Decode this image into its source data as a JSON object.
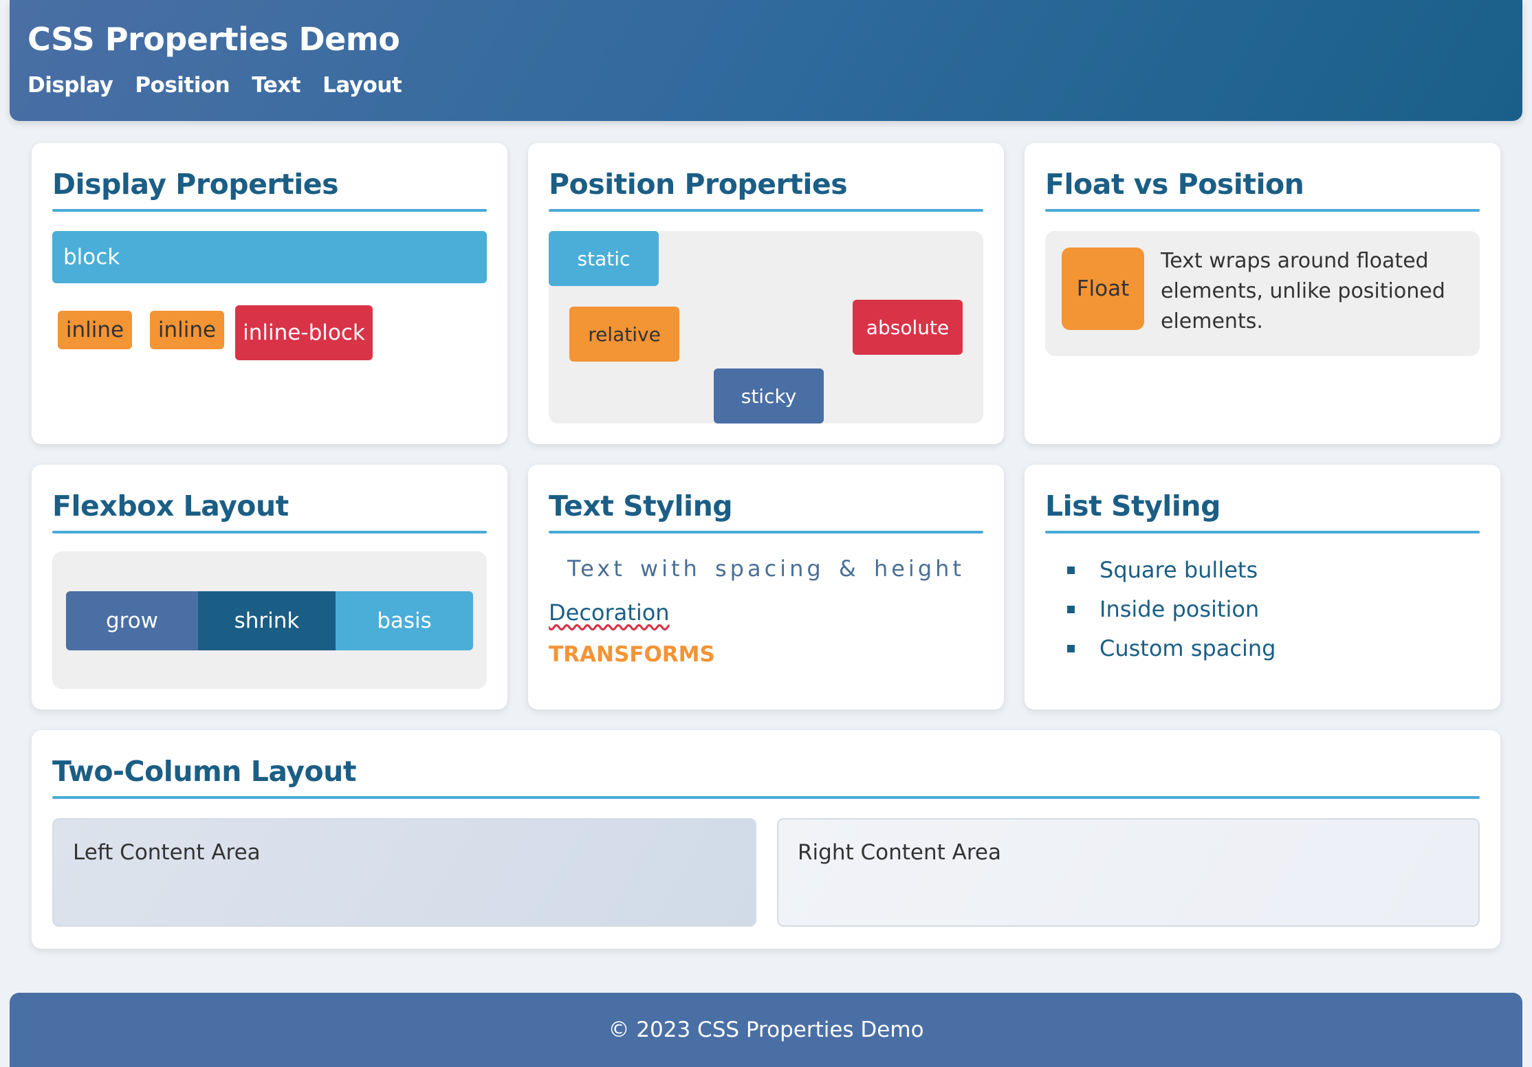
{
  "header": {
    "title": "CSS Properties Demo",
    "nav": [
      "Display",
      "Position",
      "Text",
      "Layout"
    ]
  },
  "display_card": {
    "title": "Display Properties",
    "block_label": "block",
    "inline_1": "inline",
    "inline_2": "inline",
    "inline_block": "inline-block"
  },
  "position_card": {
    "title": "Position Properties",
    "static": "static",
    "relative": "relative",
    "absolute": "absolute",
    "sticky": "sticky"
  },
  "float_card": {
    "title": "Float vs Position",
    "float_label": "Float",
    "wrap_text": "Text wraps around floated elements, unlike positioned elements."
  },
  "flex_card": {
    "title": "Flexbox Layout",
    "items": [
      "grow",
      "shrink",
      "basis"
    ]
  },
  "text_card": {
    "title": "Text Styling",
    "spacing_text": "Text with spacing & height",
    "decoration_text": "Decoration",
    "transform_text": "TRANSFORMS"
  },
  "list_card": {
    "title": "List Styling",
    "items": [
      "Square bullets",
      "Inside position",
      "Custom spacing"
    ]
  },
  "two_col_card": {
    "title": "Two-Column Layout",
    "left": "Left Content Area",
    "right": "Right Content Area"
  },
  "footer": {
    "text": "© 2023 CSS Properties Demo"
  },
  "colors": {
    "primary": "#1b5e85",
    "accent_blue": "#4aaed8",
    "orange": "#f39435",
    "red": "#d93347",
    "navy": "#4a6fa5"
  }
}
